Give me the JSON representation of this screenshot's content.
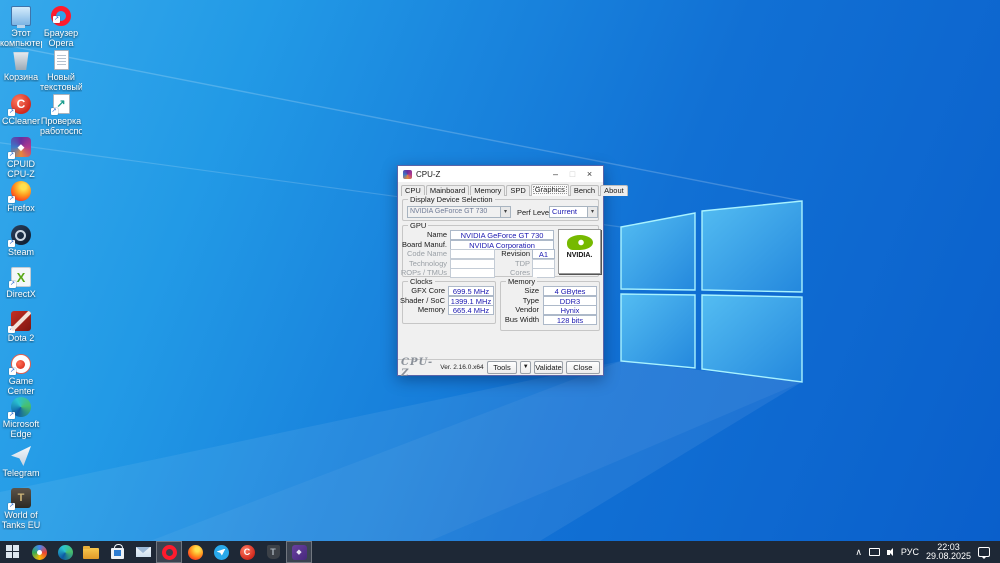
{
  "colors": {
    "desktop_top": "#36a9eb",
    "desktop_bottom": "#0a5fcb",
    "value_text": "#1a18b0",
    "taskbar": "#1e2836",
    "nvidia_green": "#76b900"
  },
  "desktop": {
    "icons": [
      {
        "label": "Этот компьютер",
        "icon": "computer-icon"
      },
      {
        "label": "Корзина",
        "icon": "recycle-bin-icon"
      },
      {
        "label": "CCleaner",
        "icon": "ccleaner-icon"
      },
      {
        "label": "CPUID CPU-Z",
        "icon": "cpu-z-icon"
      },
      {
        "label": "Firefox",
        "icon": "firefox-icon"
      },
      {
        "label": "Steam",
        "icon": "steam-icon"
      },
      {
        "label": "DirectX",
        "icon": "directx-icon"
      },
      {
        "label": "Dota 2",
        "icon": "dota2-icon"
      },
      {
        "label": "Game Center",
        "icon": "game-center-icon"
      },
      {
        "label": "Microsoft Edge",
        "icon": "edge-icon"
      },
      {
        "label": "Telegram",
        "icon": "telegram-icon"
      },
      {
        "label": "World of Tanks EU",
        "icon": "world-of-tanks-icon"
      },
      {
        "label": "Браузер Opera",
        "icon": "opera-icon"
      },
      {
        "label": "Новый текстовый...",
        "icon": "text-document-icon"
      },
      {
        "label": "Проверка работоспо...",
        "icon": "health-check-icon"
      }
    ]
  },
  "window": {
    "title": "CPU-Z",
    "controls": {
      "minimize": "–",
      "maximize": "□",
      "close": "×"
    },
    "tabs": [
      {
        "label": "CPU"
      },
      {
        "label": "Mainboard"
      },
      {
        "label": "Memory"
      },
      {
        "label": "SPD"
      },
      {
        "label": "Graphics",
        "active": true
      },
      {
        "label": "Bench"
      },
      {
        "label": "About"
      }
    ],
    "display_device": {
      "group": "Display Device Selection",
      "device": "NVIDIA GeForce GT 730",
      "perf_label": "Perf Level",
      "perf_value": "Current"
    },
    "gpu": {
      "group": "GPU",
      "name_label": "Name",
      "name": "NVIDIA GeForce GT 730",
      "board_label": "Board Manuf.",
      "board": "NVIDIA Corporation",
      "code_label": "Code Name",
      "code": "",
      "revision_label": "Revision",
      "revision": "A1",
      "tech_label": "Technology",
      "tech": "",
      "tdp_label": "TDP",
      "tdp": "",
      "rops_label": "ROPs / TMUs",
      "rops": "",
      "cores_label": "Cores",
      "cores": "",
      "logo_text": "NVIDIA."
    },
    "clocks": {
      "group": "Clocks",
      "rows": [
        {
          "label": "GFX Core",
          "value": "699.5 MHz"
        },
        {
          "label": "Shader / SoC",
          "value": "1399.1 MHz"
        },
        {
          "label": "Memory",
          "value": "665.4 MHz"
        }
      ]
    },
    "memory": {
      "group": "Memory",
      "rows": [
        {
          "label": "Size",
          "value": "4 GBytes"
        },
        {
          "label": "Type",
          "value": "DDR3"
        },
        {
          "label": "Vendor",
          "value": "Hynix"
        },
        {
          "label": "Bus Width",
          "value": "128 bits"
        }
      ]
    },
    "footer": {
      "logo": "CPU-Z",
      "version": "Ver. 2.16.0.x64",
      "tools": "Tools",
      "validate": "Validate",
      "close": "Close"
    }
  },
  "taskbar": {
    "apps": [
      "start",
      "search",
      "edge",
      "file-explorer",
      "store",
      "mail",
      "opera",
      "firefox",
      "telegram",
      "ccleaner",
      "world-of-tanks",
      "cpu-z"
    ],
    "active_apps": [
      "opera",
      "cpu-z"
    ],
    "tray": {
      "language": "РУС",
      "time": "22:03",
      "date": "29.08.2025"
    }
  }
}
